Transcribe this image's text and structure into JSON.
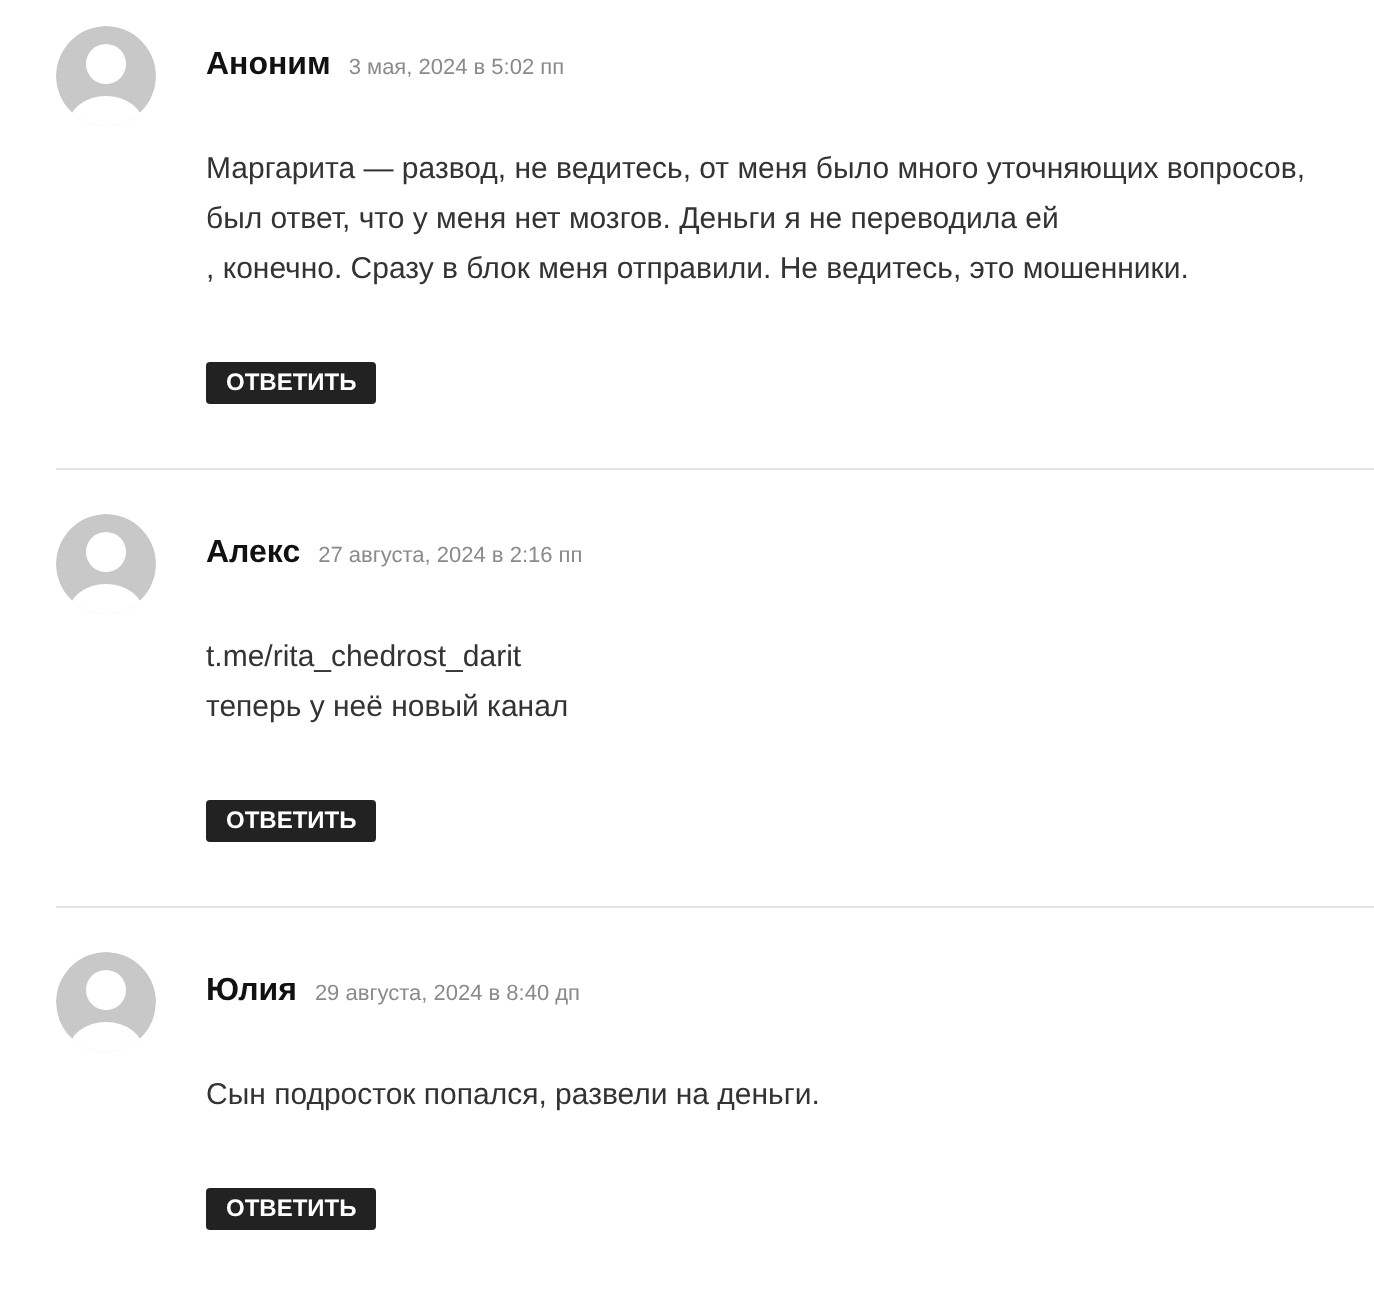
{
  "comments": [
    {
      "author": "Аноним",
      "date": "3 мая, 2024 в 5:02 пп",
      "lines": [
        "Маргарита — развод, не ведитесь, от меня было много уточняющих вопросов,",
        "был ответ, что у меня нет мозгов. Деньги я не переводила ей",
        ", конечно. Сразу в блок меня отправили. Не ведитесь, это мошенники."
      ],
      "reply": "ОТВЕТИТЬ"
    },
    {
      "author": "Алекс",
      "date": "27 августа, 2024 в 2:16 пп",
      "lines": [
        "t.me/rita_chedrost_darit",
        "теперь у неё новый канал"
      ],
      "reply": "ОТВЕТИТЬ"
    },
    {
      "author": "Юлия",
      "date": "29 августа, 2024 в 8:40 дп",
      "lines": [
        "Сын подросток попался, развели на деньги."
      ],
      "reply": "ОТВЕТИТЬ"
    }
  ]
}
